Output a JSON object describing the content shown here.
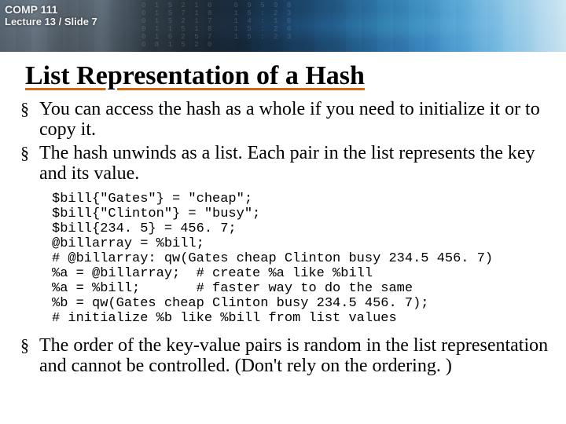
{
  "header": {
    "course_line1": "COMP 111",
    "course_line2": "Lecture 13 / Slide 7"
  },
  "title": "List Representation of a Hash",
  "bullets": {
    "b1": "You can access the hash as a whole if you need to initialize it or to copy it.",
    "b2": "The hash unwinds as a list. Each pair in the list represents the key and its value.",
    "b3": "The order of the key-value pairs is random in the list representation and cannot be controlled. (Don't rely on the ordering. )"
  },
  "code": {
    "l1": "$bill{\"Gates\"} = \"cheap\";",
    "l2": "$bill{\"Clinton\"} = \"busy\";",
    "l3": "$bill{234. 5} = 456. 7;",
    "l4": "@billarray = %bill;",
    "l5": "# @billarray: qw(Gates cheap Clinton busy 234.5 456. 7)",
    "l6": "%a = @billarray;  # create %a like %bill",
    "l7": "%a = %bill;       # faster way to do the same",
    "l8": "%b = qw(Gates cheap Clinton busy 234.5 456. 7);",
    "l9": "# initialize %b like %bill from list values"
  }
}
